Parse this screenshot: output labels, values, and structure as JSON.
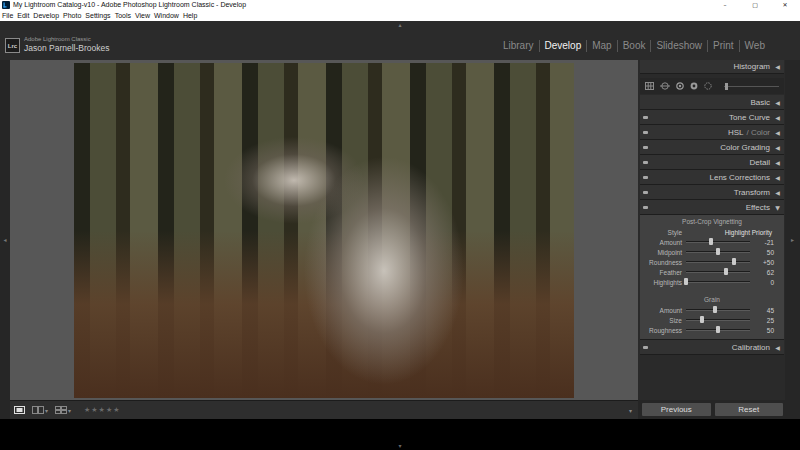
{
  "window": {
    "title": "My Lightroom Catalog-v10 - Adobe Photoshop Lightroom Classic - Develop",
    "controls": [
      "–",
      "▢",
      "✕"
    ]
  },
  "menu": [
    "File",
    "Edit",
    "Develop",
    "Photo",
    "Settings",
    "Tools",
    "View",
    "Window",
    "Help"
  ],
  "identity": {
    "logo": "Lrc",
    "product": "Adobe Lightroom Classic",
    "user": "Jason Parnell-Brookes"
  },
  "modules": [
    {
      "label": "Library",
      "selected": false
    },
    {
      "label": "Develop",
      "selected": true
    },
    {
      "label": "Map",
      "selected": false
    },
    {
      "label": "Book",
      "selected": false
    },
    {
      "label": "Slideshow",
      "selected": false
    },
    {
      "label": "Print",
      "selected": false
    },
    {
      "label": "Web",
      "selected": false
    }
  ],
  "edge_arrows": {
    "top": "▴",
    "left": "◂",
    "right": "▸",
    "bottom": "▾"
  },
  "histogram": {
    "label": "Histogram",
    "arrow": "◀"
  },
  "tool_strip": {
    "level": 0.05
  },
  "panels": [
    {
      "label": "Basic",
      "kind": "plain",
      "expanded": false,
      "arrow": "◀"
    },
    {
      "label": "Tone Curve",
      "kind": "toggle",
      "expanded": false,
      "arrow": "◀"
    },
    {
      "label": "HSL",
      "label_dim": "/ Color",
      "kind": "toggle",
      "expanded": false,
      "arrow": "◀"
    },
    {
      "label": "Color Grading",
      "kind": "toggle",
      "expanded": false,
      "arrow": "◀"
    },
    {
      "label": "Detail",
      "kind": "toggle",
      "expanded": false,
      "arrow": "◀"
    },
    {
      "label": "Lens Corrections",
      "kind": "toggle",
      "expanded": false,
      "arrow": "◀"
    },
    {
      "label": "Transform",
      "kind": "toggle",
      "expanded": false,
      "arrow": "◀"
    },
    {
      "label": "Effects",
      "kind": "toggle",
      "expanded": true,
      "arrow": "▼",
      "content": {
        "vignette": {
          "title": "Post-Crop Vignetting",
          "style": {
            "label": "Style",
            "value": "Highlight Priority"
          },
          "sliders": [
            {
              "label": "Amount",
              "level": 0.395,
              "reading": "-21"
            },
            {
              "label": "Midpoint",
              "level": 0.5,
              "reading": "50"
            },
            {
              "label": "Roundness",
              "level": 0.75,
              "reading": "+50"
            },
            {
              "label": "Feather",
              "level": 0.62,
              "reading": "62"
            },
            {
              "label": "Highlights",
              "level": 0,
              "reading": "0"
            }
          ]
        },
        "grain": {
          "title": "Grain",
          "sliders": [
            {
              "label": "Amount",
              "level": 0.45,
              "reading": "45"
            },
            {
              "label": "Size",
              "level": 0.25,
              "reading": "25"
            },
            {
              "label": "Roughness",
              "level": 0.5,
              "reading": "50"
            }
          ]
        }
      }
    },
    {
      "label": "Calibration",
      "kind": "toggle",
      "expanded": false,
      "arrow": "◀"
    }
  ],
  "toolbar": {
    "view_modes": [
      {
        "kind": "loupe",
        "selected": true,
        "caret": ""
      },
      {
        "kind": "compare",
        "selected": false,
        "caret": "▾"
      },
      {
        "kind": "survey",
        "selected": false,
        "caret": "▾"
      }
    ],
    "rating": {
      "stars": 0,
      "marks": [
        "★",
        "★",
        "★",
        "★",
        "★"
      ]
    },
    "menu_caret": "▾"
  },
  "buttons": [
    "Previous",
    "Reset"
  ]
}
